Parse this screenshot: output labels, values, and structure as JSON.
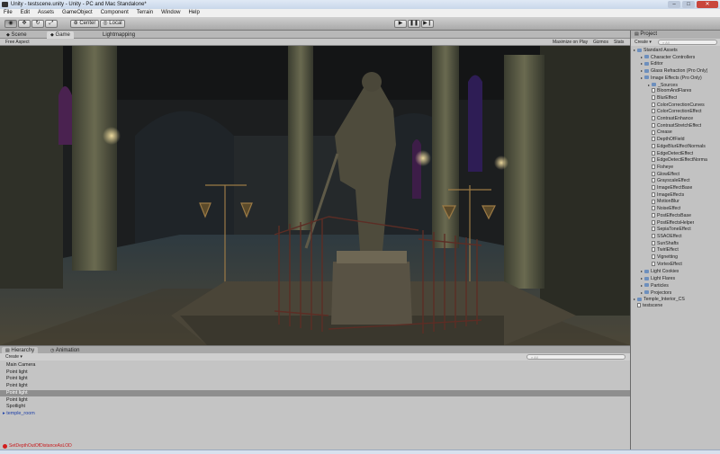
{
  "window": {
    "title": "Unity - testscene.unity - Unity - PC and Mac Standalone*"
  },
  "menu": [
    "File",
    "Edit",
    "Assets",
    "GameObject",
    "Component",
    "Terrain",
    "Window",
    "Help"
  ],
  "toolbar": {
    "pivot_label": "Center",
    "space_label": "Local",
    "play_icon": "play-icon",
    "pause_icon": "pause-icon",
    "step_icon": "step-icon"
  },
  "view_tabs": {
    "scene": "Scene",
    "game": "Game",
    "lightmapping": "Lightmapping"
  },
  "scene_options": {
    "aspect": "Free Aspect",
    "maximize": "Maximize on Play",
    "gizmos": "Gizmos",
    "stats": "Stats"
  },
  "project": {
    "tab": "Project",
    "create": "Create",
    "search_placeholder": "All",
    "tree": [
      {
        "label": "Standard Assets",
        "type": "folder",
        "depth": 0
      },
      {
        "label": "Character Controllers",
        "type": "folder",
        "depth": 1
      },
      {
        "label": "Editor",
        "type": "folder",
        "depth": 1
      },
      {
        "label": "Glass Refraction (Pro Only)",
        "type": "folder",
        "depth": 1
      },
      {
        "label": "Image Effects (Pro Only)",
        "type": "folder",
        "depth": 1
      },
      {
        "label": "_Sources",
        "type": "folder",
        "depth": 2
      },
      {
        "label": "BloomAndFlares",
        "type": "file",
        "depth": 2
      },
      {
        "label": "BlurEffect",
        "type": "file",
        "depth": 2
      },
      {
        "label": "ColorCorrectionCurves",
        "type": "file",
        "depth": 2
      },
      {
        "label": "ColorCorrectionEffect",
        "type": "file",
        "depth": 2
      },
      {
        "label": "ContrastEnhance",
        "type": "file",
        "depth": 2
      },
      {
        "label": "ContrastStretchEffect",
        "type": "file",
        "depth": 2
      },
      {
        "label": "Crease",
        "type": "file",
        "depth": 2
      },
      {
        "label": "DepthOfField",
        "type": "file",
        "depth": 2
      },
      {
        "label": "EdgeBlurEffectNormals",
        "type": "file",
        "depth": 2
      },
      {
        "label": "EdgeDetectEffect",
        "type": "file",
        "depth": 2
      },
      {
        "label": "EdgeDetectEffectNorma",
        "type": "file",
        "depth": 2
      },
      {
        "label": "Fisheye",
        "type": "file",
        "depth": 2
      },
      {
        "label": "GlowEffect",
        "type": "file",
        "depth": 2
      },
      {
        "label": "GrayscaleEffect",
        "type": "file",
        "depth": 2
      },
      {
        "label": "ImageEffectBase",
        "type": "file",
        "depth": 2
      },
      {
        "label": "ImageEffects",
        "type": "file",
        "depth": 2
      },
      {
        "label": "MotionBlur",
        "type": "file",
        "depth": 2
      },
      {
        "label": "NoiseEffect",
        "type": "file",
        "depth": 2
      },
      {
        "label": "PostEffectsBase",
        "type": "file",
        "depth": 2
      },
      {
        "label": "PostEffectsHelper",
        "type": "file",
        "depth": 2
      },
      {
        "label": "SepiaToneEffect",
        "type": "file",
        "depth": 2
      },
      {
        "label": "SSAOEffect",
        "type": "file",
        "depth": 2
      },
      {
        "label": "SunShafts",
        "type": "file",
        "depth": 2
      },
      {
        "label": "TwirlEffect",
        "type": "file",
        "depth": 2
      },
      {
        "label": "Vignetting",
        "type": "file",
        "depth": 2
      },
      {
        "label": "VortexEffect",
        "type": "file",
        "depth": 2
      },
      {
        "label": "Light Cookies",
        "type": "folder",
        "depth": 1
      },
      {
        "label": "Light Flares",
        "type": "folder",
        "depth": 1
      },
      {
        "label": "Particles",
        "type": "folder",
        "depth": 1
      },
      {
        "label": "Projectors",
        "type": "folder",
        "depth": 1
      },
      {
        "label": "Temple_Interior_CS",
        "type": "folder",
        "depth": 0
      },
      {
        "label": "testscene",
        "type": "scene",
        "depth": 0
      }
    ]
  },
  "hierarchy": {
    "tab": "Hierarchy",
    "animation_tab": "Animation",
    "create": "Create",
    "search_placeholder": "All",
    "items": [
      {
        "label": "Main Camera",
        "selected": false,
        "prefab": false
      },
      {
        "label": "Point light",
        "selected": false,
        "prefab": false
      },
      {
        "label": "Point light",
        "selected": false,
        "prefab": false
      },
      {
        "label": "Point light",
        "selected": false,
        "prefab": false
      },
      {
        "label": "Point light",
        "selected": true,
        "prefab": false
      },
      {
        "label": "Point light",
        "selected": false,
        "prefab": false
      },
      {
        "label": "Spotlight",
        "selected": false,
        "prefab": false
      },
      {
        "label": "temple_room",
        "selected": false,
        "prefab": true
      }
    ]
  },
  "status": {
    "message": "SetDepthOutOfDistanceAsLOD"
  }
}
